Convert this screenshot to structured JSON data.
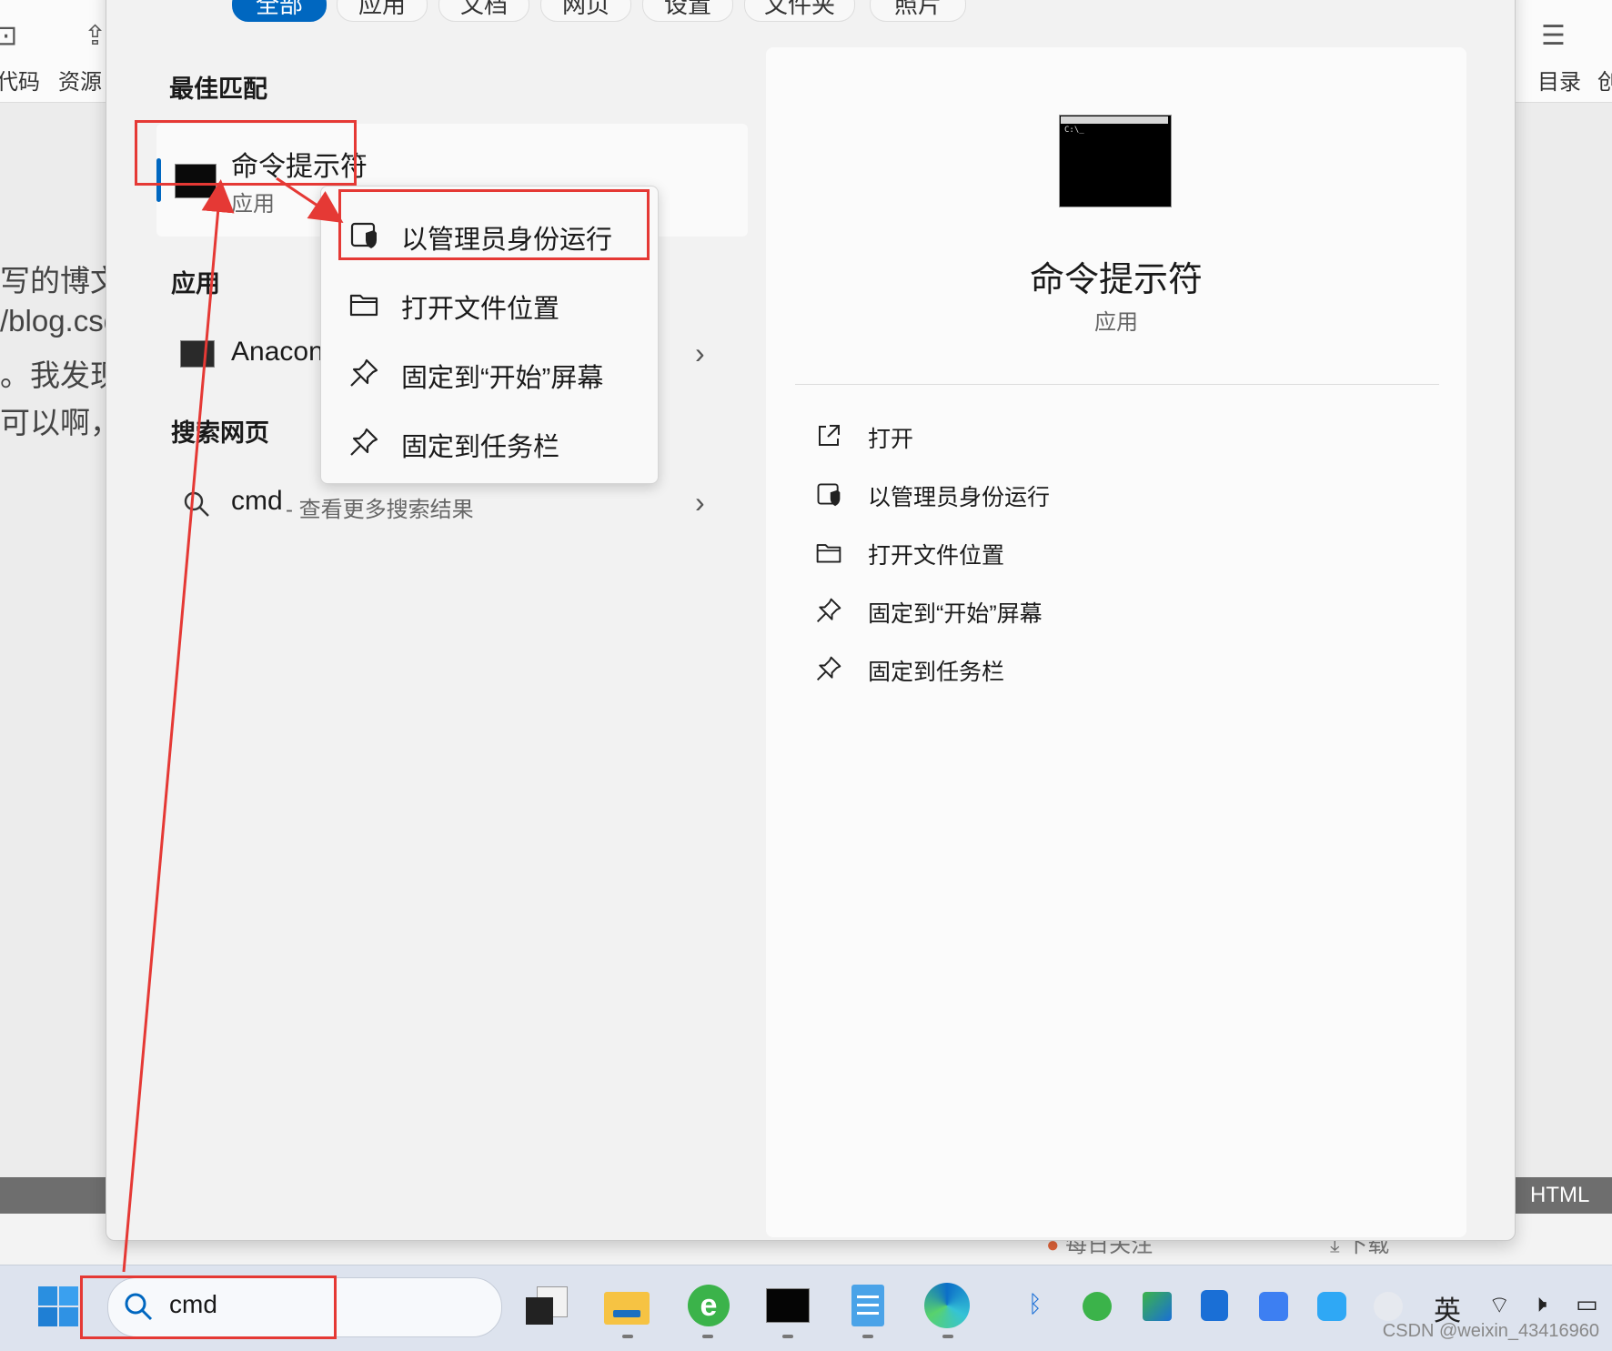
{
  "background_page": {
    "toolbar": {
      "left_items": [
        "代码",
        "资源"
      ],
      "right_items": [
        "目录",
        "创"
      ]
    },
    "text_lines": [
      "写的博文",
      "/blog.csd",
      "。我发现",
      "可以啊，我"
    ],
    "bottom_bar_label": "HTML",
    "bottom_strip": [
      "每日关注",
      "下载"
    ]
  },
  "start_menu": {
    "filter_tabs": [
      {
        "label": "全部",
        "active": true
      },
      {
        "label": "应用"
      },
      {
        "label": "文档"
      },
      {
        "label": "网页"
      },
      {
        "label": "设置"
      },
      {
        "label": "文件夹"
      },
      {
        "label": "照片"
      }
    ],
    "best_match": {
      "section_title": "最佳匹配",
      "name": "命令提示符",
      "type": "应用"
    },
    "apps": {
      "section_title": "应用",
      "items": [
        {
          "name": "Anacon"
        }
      ]
    },
    "web_search": {
      "section_title": "搜索网页",
      "query": "cmd",
      "hint": " - 查看更多搜索结果"
    },
    "context_menu": {
      "items": [
        {
          "label": "以管理员身份运行",
          "icon": "shield-icon"
        },
        {
          "label": "打开文件位置",
          "icon": "folder-icon"
        },
        {
          "label": "固定到“开始”屏幕",
          "icon": "pin-icon"
        },
        {
          "label": "固定到任务栏",
          "icon": "pin-icon"
        }
      ]
    },
    "preview": {
      "title": "命令提示符",
      "subtitle": "应用",
      "actions": [
        {
          "label": "打开",
          "icon": "open-external-icon"
        },
        {
          "label": "以管理员身份运行",
          "icon": "shield-icon"
        },
        {
          "label": "打开文件位置",
          "icon": "folder-icon"
        },
        {
          "label": "固定到“开始”屏幕",
          "icon": "pin-icon"
        },
        {
          "label": "固定到任务栏",
          "icon": "pin-icon"
        }
      ]
    }
  },
  "taskbar": {
    "search_value": "cmd",
    "apps": [
      "task-view",
      "file-explorer",
      "ie-browser",
      "command-prompt",
      "notepad",
      "edge-browser"
    ],
    "ime_label": "英"
  },
  "watermark": "CSDN @weixin_43416960",
  "colors": {
    "accent": "#0067c0",
    "annotation_red": "#e53935"
  }
}
